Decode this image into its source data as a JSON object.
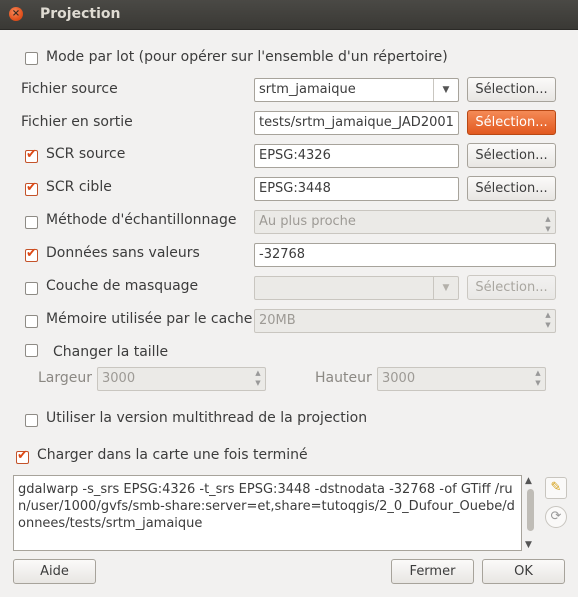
{
  "window": {
    "title": "Projection"
  },
  "batch_mode": {
    "label": "Mode par lot (pour opérer sur l'ensemble d'un répertoire)",
    "checked": false
  },
  "source_file": {
    "label": "Fichier source",
    "value": "srtm_jamaique",
    "button": "Sélection..."
  },
  "output_file": {
    "label": "Fichier en sortie",
    "value": "tests/srtm_jamaique_JAD2001",
    "button": "Sélection..."
  },
  "source_crs": {
    "label": "SCR source",
    "checked": true,
    "value": "EPSG:4326",
    "button": "Sélection..."
  },
  "target_crs": {
    "label": "SCR cible",
    "checked": true,
    "value": "EPSG:3448",
    "button": "Sélection..."
  },
  "resampling": {
    "label": "Méthode d'échantillonnage",
    "checked": false,
    "value": "Au plus proche"
  },
  "nodata": {
    "label": "Données sans valeurs",
    "checked": true,
    "value": "-32768"
  },
  "mask_layer": {
    "label": "Couche de masquage",
    "checked": false,
    "value": "",
    "button": "Sélection..."
  },
  "cache_memory": {
    "label": "Mémoire utilisée par le cache",
    "checked": false,
    "value": "20MB"
  },
  "resize": {
    "label": "Changer la taille",
    "checked": false,
    "width_label": "Largeur",
    "width_value": "3000",
    "height_label": "Hauteur",
    "height_value": "3000"
  },
  "multithread": {
    "label": "Utiliser la version multithread de la projection",
    "checked": false
  },
  "load_in_map": {
    "label": "Charger dans la carte une fois terminé",
    "checked": true
  },
  "command": {
    "text": "gdalwarp -s_srs EPSG:4326 -t_srs EPSG:3448 -dstnodata -32768 -of GTiff /run/user/1000/gvfs/smb-share:server=et,share=tutoqgis/2_0_Dufour_Ouebe/donnees/tests/srtm_jamaique"
  },
  "icons": {
    "edit": "pencil-icon",
    "reset": "reset-icon"
  },
  "footer": {
    "help": "Aide",
    "close": "Fermer",
    "ok": "OK"
  },
  "colors": {
    "accent": "#dd4814",
    "window_bg": "#f2f1f0",
    "titlebar": "#3c3b37"
  }
}
